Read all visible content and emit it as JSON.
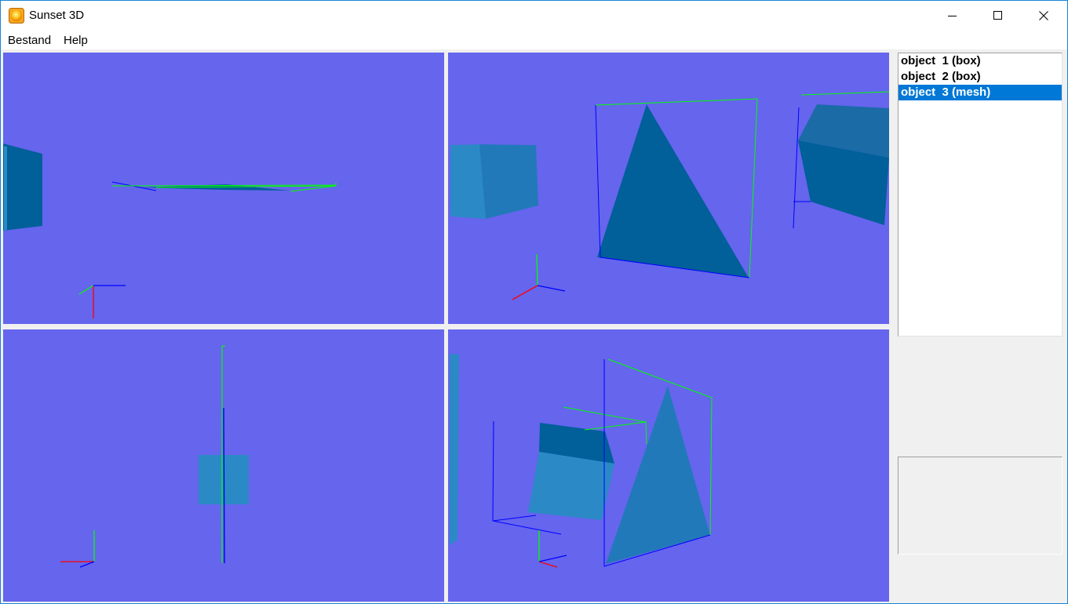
{
  "window": {
    "title": "Sunset 3D",
    "controls": {
      "minimize": "minimize",
      "maximize": "maximize",
      "close": "close"
    }
  },
  "menu": {
    "items": [
      "Bestand",
      "Help"
    ]
  },
  "objects": {
    "items": [
      "object  1 (box)",
      "object  2 (box)",
      "object  3 (mesh)"
    ],
    "selected_index": 2
  },
  "colors": {
    "viewport_bg": "#6565ee",
    "selection": "#0078d7",
    "axis_x": "#ff0000",
    "axis_y": "#00ff00",
    "axis_z": "#0000ff",
    "face_dark": "#015f99",
    "face_mid": "#2279b9",
    "face_light": "#2b8ac5"
  },
  "viewports": [
    {
      "name": "top-left"
    },
    {
      "name": "top-right"
    },
    {
      "name": "bottom-left"
    },
    {
      "name": "bottom-right"
    }
  ]
}
